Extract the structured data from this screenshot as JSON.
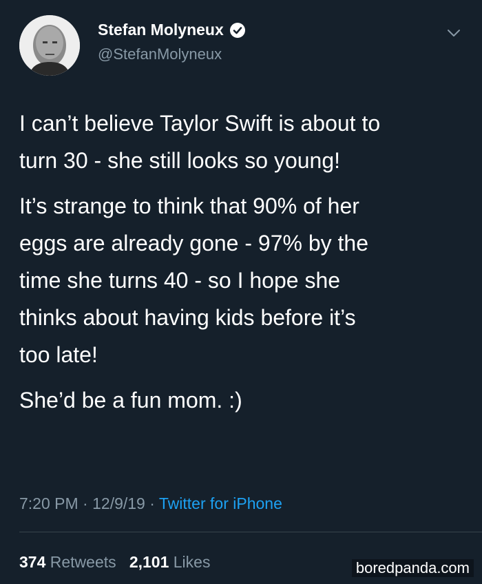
{
  "user": {
    "name": "Stefan Molyneux",
    "handle": "@StefanMolyneux",
    "verified_icon": "verified-badge-icon"
  },
  "tweet": {
    "p1": "I can’t believe Taylor Swift is about to\nturn 30 - she still looks so young!",
    "p2": "It’s strange to think that 90% of her\neggs are already gone - 97% by the\ntime she turns 40 - so I hope she\nthinks about having kids before it’s\ntoo late!",
    "p3": "She’d be a fun mom. :)"
  },
  "meta": {
    "time": "7:20 PM",
    "sep1": " · ",
    "date": "12/9/19",
    "sep2": " · ",
    "source": "Twitter for iPhone"
  },
  "stats": {
    "retweets_count": "374",
    "retweets_label": "Retweets",
    "likes_count": "2,101",
    "likes_label": "Likes"
  },
  "watermark": "boredpanda.com",
  "colors": {
    "background": "#15202b",
    "secondary_text": "#8899a6",
    "link": "#1da1f2"
  }
}
